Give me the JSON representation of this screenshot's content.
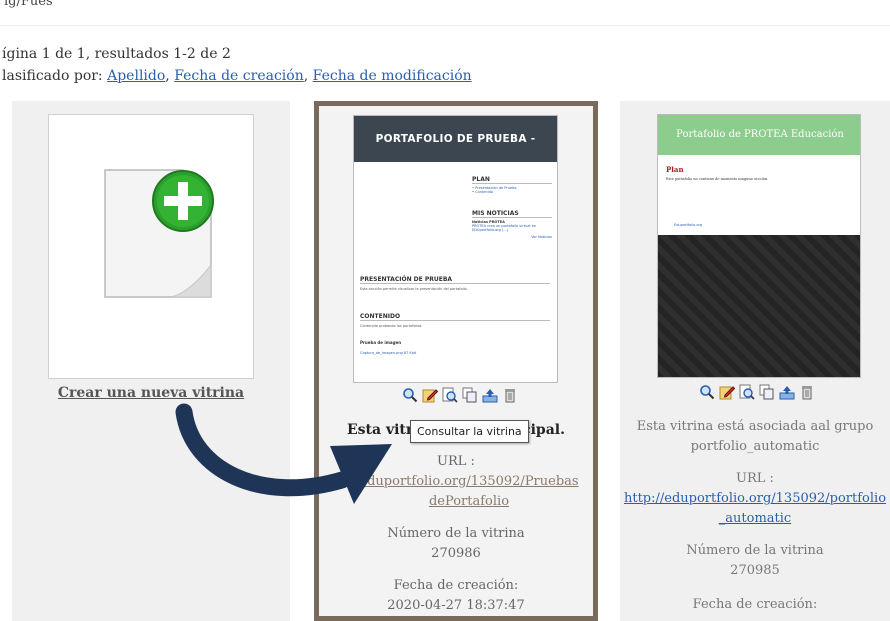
{
  "top_strip": {
    "text": "ıg/Fues"
  },
  "pager": {
    "text": "ígina 1 de 1, resultados 1-2 de 2"
  },
  "sort": {
    "label": "lasificado por:",
    "links": [
      "Apellido",
      "Fecha de creación",
      "Fecha de modificación"
    ],
    "separator": ","
  },
  "new_card": {
    "link": "Crear una nueva vitrina"
  },
  "card_main": {
    "thumb": {
      "banner": "PORTAFOLIO DE PRUEBA - PROTEA",
      "plan": "PLAN",
      "plan_items": [
        "• Presentación de Prueba",
        "• Contenido"
      ],
      "news": "MIS NOTICIAS",
      "news_title": "Noticias PROTEA",
      "news_text": "PROTEA crea un portafolio virtual en EDUportfolio.org (...)",
      "news_more": "Ver Noticias",
      "section1": "PRESENTACIÓN DE PRUEBA",
      "section1_text": "Esta sección permite visualizar la presentación del portafolio.",
      "section2": "CONTENIDO",
      "section2_text": "Contenido probando los portafolios",
      "section3": "Prueba de imagen",
      "section3_text": "Captura_de_imagen.png 87 Kbit"
    },
    "heading_start": "Esta vitrin",
    "heading_end": "icipal.",
    "url_label": "URL :",
    "url": "eduportfolio.org/135092/PruebasdePortafolio",
    "number_label": "Número de la vitrina",
    "number": "270986",
    "date_label": "Fecha de creación:",
    "date": "2020-04-27 18:37:47"
  },
  "card_other": {
    "thumb": {
      "banner": "Portafolio de PROTEA Educación",
      "plan": "Plan",
      "plan_text": "Este portafolio no contiene de momento ninguna sección.",
      "footer": "Eduportfolio.org"
    },
    "heading": "Esta vitrina está asociada aal grupo portfolio_automatic",
    "url_label": "URL :",
    "url": "http://eduportfolio.org/135092/portfolio_automatic",
    "number_label": "Número de la vitrina",
    "number": "270985",
    "date_label": "Fecha de creación:"
  },
  "tooltip": {
    "text": "Consultar la vitrina"
  },
  "colors": {
    "link": "#2a5db0",
    "arrow": "#1f3557",
    "plus": "#2ca02c",
    "banner_main": "#3b4651",
    "banner_other": "#8ccc8c"
  }
}
